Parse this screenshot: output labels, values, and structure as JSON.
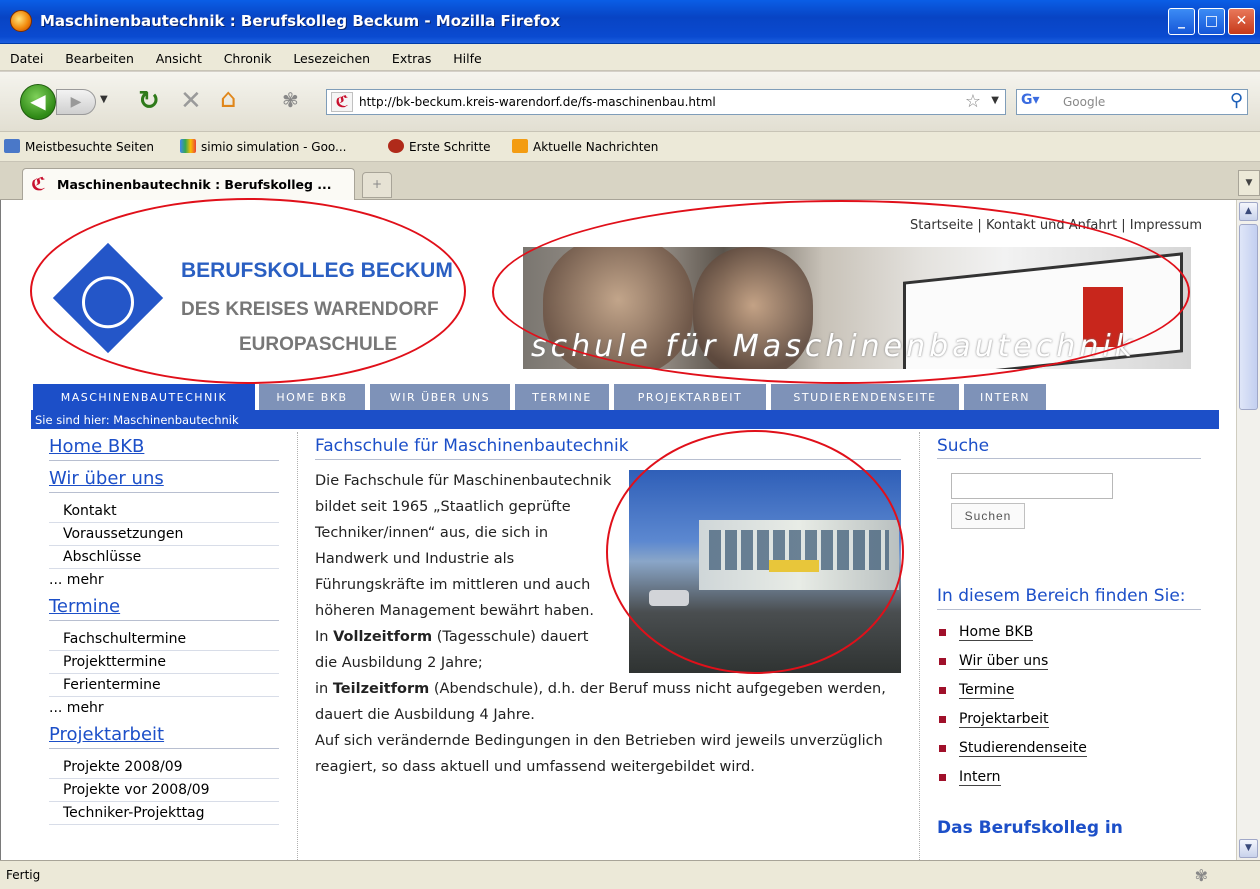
{
  "window": {
    "title": "Maschinenbautechnik : Berufskolleg Beckum - Mozilla Firefox",
    "minimize": "_",
    "maximize": "□",
    "close": "✕"
  },
  "menu": [
    "Datei",
    "Bearbeiten",
    "Ansicht",
    "Chronik",
    "Lesezeichen",
    "Extras",
    "Hilfe"
  ],
  "toolbar": {
    "url": "http://bk-beckum.kreis-warendorf.de/fs-maschinenbau.html",
    "search_placeholder": "Google"
  },
  "bookmarks": [
    "Meistbesuchte Seiten",
    "simio simulation - Goo...",
    "Erste Schritte",
    "Aktuelle Nachrichten"
  ],
  "tab": {
    "label": "Maschinenbautechnik : Berufskolleg ..."
  },
  "page": {
    "top_links": {
      "startseite": "Startseite",
      "sep": " | ",
      "kontakt": "Kontakt und Anfahrt",
      "impressum": "Impressum"
    },
    "logo": {
      "line1": "BERUFSKOLLEG BECKUM",
      "line2": "DES KREISES WARENDORF",
      "line3": "EUROPASCHULE"
    },
    "banner_slogan": "schule für Maschinenbautechnik",
    "nav_tabs": [
      "MASCHINENBAUTECHNIK",
      "HOME BKB",
      "WIR ÜBER UNS",
      "TERMINE",
      "PROJEKTARBEIT",
      "STUDIERENDENSEITE",
      "INTERN"
    ],
    "breadcrumb": "Sie sind hier: Maschinenbautechnik",
    "left_nav": {
      "home": "Home BKB",
      "wir": "Wir über uns",
      "wir_items": [
        "Kontakt",
        "Voraussetzungen",
        "Abschlüsse"
      ],
      "wir_more": "... mehr",
      "termine": "Termine",
      "termine_items": [
        "Fachschultermine",
        "Projekttermine",
        "Ferientermine"
      ],
      "termine_more": "... mehr",
      "projekt": "Projektarbeit",
      "projekt_items": [
        "Projekte 2008/09",
        "Projekte vor 2008/09",
        "Techniker-Projekttag"
      ]
    },
    "main": {
      "title": "Fachschule für Maschinenbautechnik",
      "p1": "Die Fachschule für Maschinenbautechnik bildet seit 1965 „Staatlich geprüfte Techniker/innen“ aus, die sich in Handwerk und Industrie als Führungskräfte im mittleren und auch höheren Management bewährt haben.",
      "p2_pre": "In ",
      "p2_bold": "Vollzeitform",
      "p2_post": " (Tagesschule) dauert die Ausbildung 2 Jahre;",
      "p3_pre": "in ",
      "p3_bold": "Teilzeitform",
      "p3_post": " (Abendschule), d.h. der Beruf muss nicht aufgegeben werden, dauert die Ausbildung 4 Jahre.",
      "p4": "Auf sich verändernde Bedingungen in den Betrieben wird jeweils unverzüglich reagiert, so dass aktuell und umfassend weitergebildet wird."
    },
    "right": {
      "search_title": "Suche",
      "search_button": "Suchen",
      "area_title": "In diesem Bereich finden Sie:",
      "area_items": [
        "Home BKB",
        "Wir über uns",
        "Termine",
        "Projektarbeit",
        "Studierendenseite",
        "Intern"
      ],
      "bottom_title": "Das Berufskolleg in"
    }
  },
  "status": {
    "text": "Fertig"
  },
  "colors": {
    "accent": "#1c4fc8",
    "nav_tab": "#7e92b8",
    "annotation": "#e0101a"
  }
}
